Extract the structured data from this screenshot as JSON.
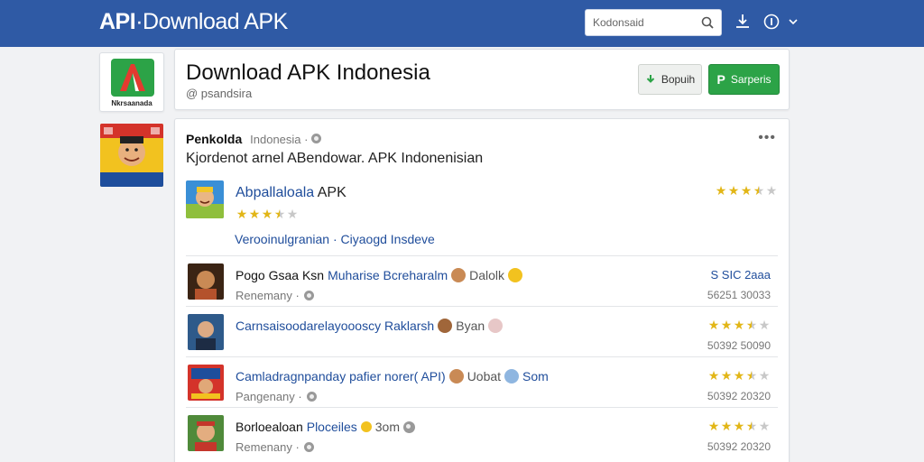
{
  "app": {
    "brand_bold": "API",
    "brand_rest": "·Download APK"
  },
  "search": {
    "value": "Kodonsaid",
    "placeholder": "Kodonsaid"
  },
  "header": {
    "logo_label": "Nkrsaanada",
    "title": "Download APK Indonesia",
    "subtitle": "@ psandsira",
    "button_gray": "Bopuih",
    "button_green": "Sarperis"
  },
  "post": {
    "author": "Penkolda",
    "meta": "Indonesia ·",
    "description": "Kjordenot arnel ABendowar. APK Indonenisian"
  },
  "featured": {
    "name": "Abpallaloala",
    "name_suffix": "APK",
    "rating": 3.5,
    "links": "Verooinulgranian   · Ciyaogd Insdeve"
  },
  "rows": [
    {
      "name": "Pogo Gsaa Ksn",
      "name_link": "Muharise Bcreharalm",
      "extra": "Dalolk",
      "sub": "Renemany ·",
      "right_top": "S SIC 2aaa",
      "right_bottom": "56251 30033",
      "rating": null
    },
    {
      "name": "",
      "name_link": "Carnsaisoodarelayoooscy Raklarsh",
      "extra": "Byan",
      "sub": "",
      "right_top": "",
      "right_bottom": "50392 50090",
      "rating": 3.5
    },
    {
      "name": "",
      "name_link": "Camladragnpanday pafier norer( API)",
      "extra": "Uobat",
      "extra2": "Som",
      "sub": "Pangenany ·",
      "right_top": "",
      "right_bottom": "50392 20320",
      "rating": 3.5
    },
    {
      "name": "Borloealoan",
      "name_link": "Ploceiles",
      "extra": "3om",
      "sub": "Remenany ·",
      "right_top": "",
      "right_bottom": "50392 20320",
      "rating": 3.5
    }
  ],
  "icons": {
    "search": "search-icon",
    "download": "download-icon",
    "info": "info-icon",
    "more": "more-icon",
    "globe": "globe-icon"
  },
  "colors": {
    "topbar": "#2f5aa5",
    "accent_green": "#2ca347",
    "link_blue": "#1f4d9b",
    "star": "#e2b617"
  }
}
